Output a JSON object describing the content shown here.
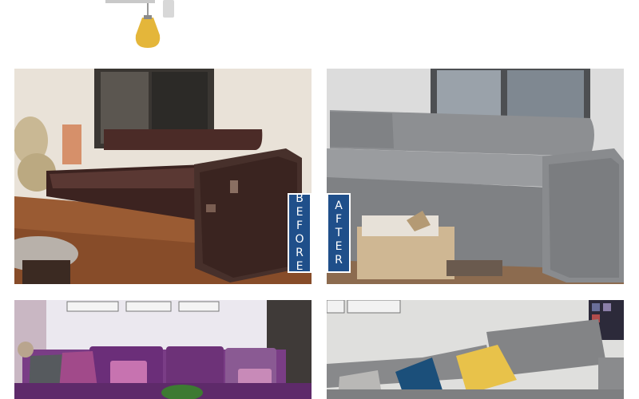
{
  "labels": {
    "before": "BEFORE",
    "after": "AFTER"
  },
  "colors": {
    "label_bg": "#1f4f8a",
    "leather_sofa": "#4a2a26",
    "grey_cover": "#8a8c8e",
    "purple_sofa": "#6b3a7a",
    "pillow_yellow": "#e8c24a",
    "pillow_blue": "#1b4f7a",
    "lamp_yellow": "#e4b63a"
  }
}
